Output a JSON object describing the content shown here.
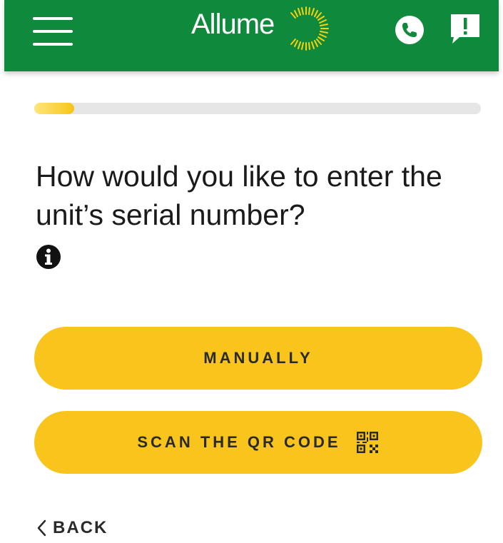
{
  "header": {
    "logo_text": "Allume",
    "background_color": "#0f8a3c",
    "icons": [
      "menu-icon",
      "phone-icon",
      "feedback-icon"
    ]
  },
  "progress": {
    "value_percent": 9,
    "fill_color": "#f6c519"
  },
  "main": {
    "question": "How would you like to enter the unit’s serial number?",
    "info_icon": "info-icon"
  },
  "buttons": {
    "manual_label": "MANUALLY",
    "scan_label": "SCAN THE QR CODE",
    "scan_icon": "qr-code-icon",
    "color": "#f9c41c"
  },
  "footer": {
    "back_label": "BACK",
    "back_icon": "chevron-left-icon"
  }
}
